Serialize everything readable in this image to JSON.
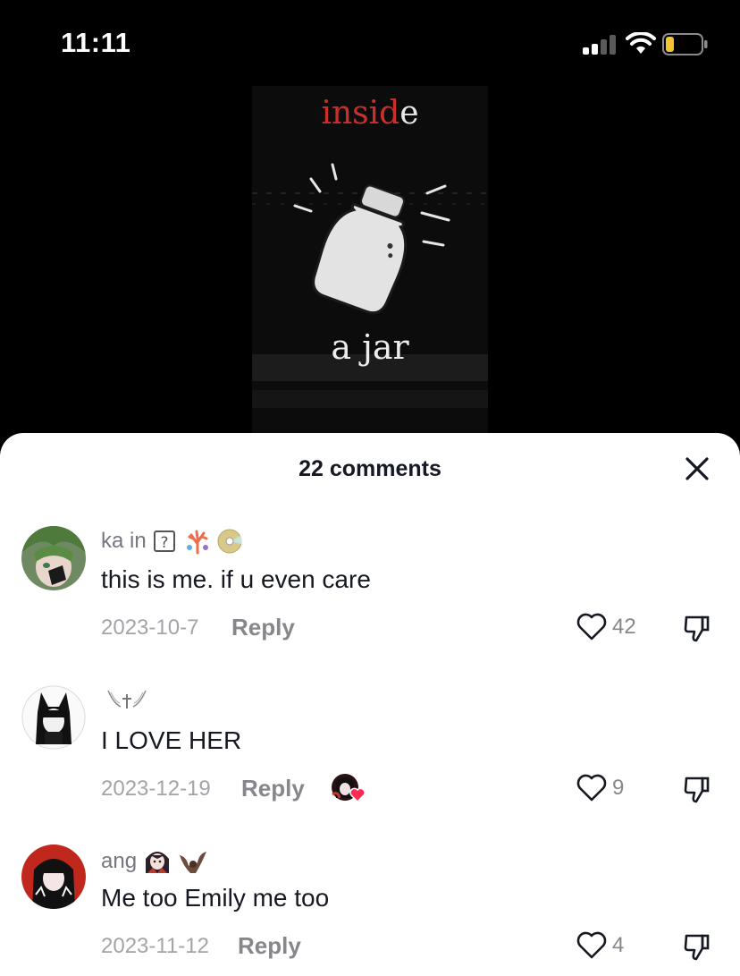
{
  "status_bar": {
    "time": "11:11"
  },
  "video": {
    "title_top_red": "insid",
    "title_top_white": "e",
    "title_bottom": "a jar"
  },
  "sheet": {
    "title": "22 comments"
  },
  "comments": [
    {
      "username": "ka in",
      "text": "this is me. if u even care",
      "date": "2023-10-7",
      "reply": "Reply",
      "likes": "42",
      "icons": [
        "question-box-icon",
        "coral-icon",
        "disc-icon"
      ]
    },
    {
      "username": "",
      "text": "I LOVE HER",
      "date": "2023-12-19",
      "reply": "Reply",
      "likes": "9",
      "icons": [
        "winged-cross-icon",
        "creator-liked-icon"
      ]
    },
    {
      "username": "ang",
      "text": "Me too Emily me too",
      "date": "2023-11-12",
      "reply": "Reply",
      "likes": "4",
      "icons": [
        "vampire-icon",
        "bat-icon"
      ]
    }
  ],
  "colors": {
    "accent_heart": "#fe2c55",
    "text_primary": "#161823",
    "text_secondary": "#86878b"
  }
}
